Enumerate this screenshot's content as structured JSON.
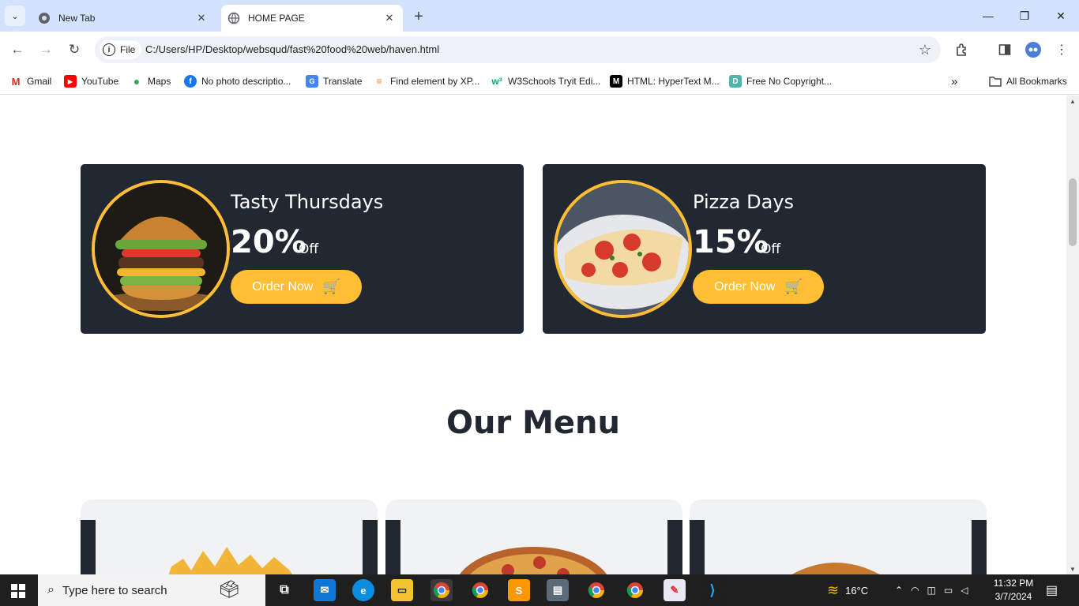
{
  "browser": {
    "tabs": [
      {
        "title": "New Tab",
        "active": false
      },
      {
        "title": "HOME PAGE",
        "active": true
      }
    ],
    "new_tab_symbol": "+",
    "address": {
      "scheme_chip": "File",
      "url": "C:/Users/HP/Desktop/websqud/fast%20food%20web/haven.html"
    },
    "bookmarks": [
      {
        "label": "Gmail",
        "icon": "gmail-icon"
      },
      {
        "label": "YouTube",
        "icon": "youtube-icon"
      },
      {
        "label": "Maps",
        "icon": "maps-icon"
      },
      {
        "label": "No photo descriptio...",
        "icon": "facebook-icon"
      },
      {
        "label": "Translate",
        "icon": "translate-icon"
      },
      {
        "label": "Find element by XP...",
        "icon": "stackoverflow-icon"
      },
      {
        "label": "W3Schools Tryit Edi...",
        "icon": "w3schools-icon"
      },
      {
        "label": "HTML: HyperText M...",
        "icon": "mdn-icon"
      },
      {
        "label": "Free No Copyright...",
        "icon": "bookmark-d-icon"
      }
    ],
    "all_bookmarks": "All Bookmarks"
  },
  "page": {
    "offers": [
      {
        "title": "Tasty Thursdays",
        "percent": "20%",
        "off": "Off",
        "button": "Order Now",
        "image": "burger"
      },
      {
        "title": "Pizza Days",
        "percent": "15%",
        "off": "Off",
        "button": "Order Now",
        "image": "pizza"
      }
    ],
    "menu_heading": "Our Menu",
    "menu_cards": [
      "fries",
      "pizza",
      "burger"
    ]
  },
  "taskbar": {
    "search_placeholder": "Type here to search",
    "weather": "16°C",
    "time": "11:32 PM",
    "date": "3/7/2024"
  },
  "colors": {
    "accent": "#ffbe33",
    "dark": "#222831",
    "tabstrip": "#d3e3fd"
  }
}
